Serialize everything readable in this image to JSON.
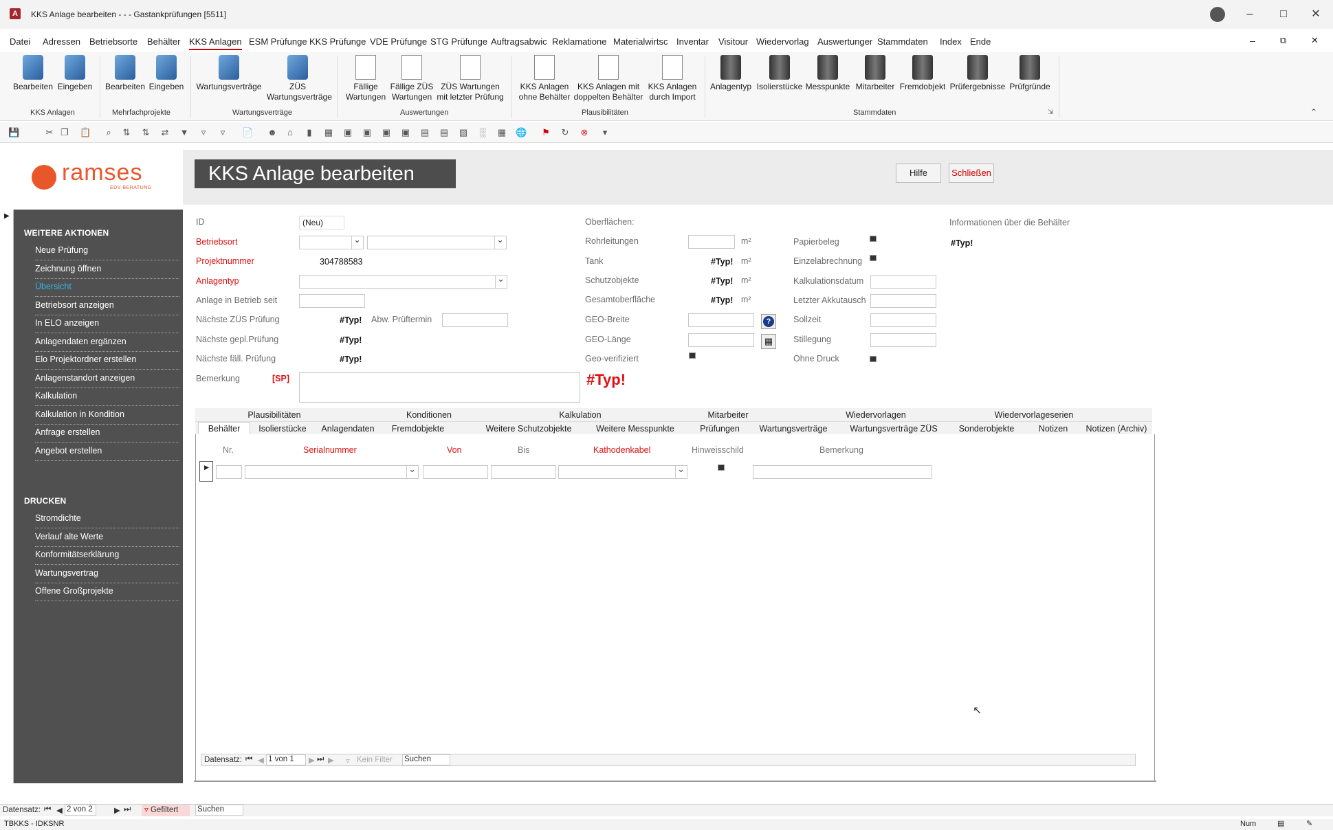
{
  "window": {
    "title": "KKS Anlage bearbeiten -  -  -  Gastankprüfungen [5511]"
  },
  "menu": [
    "Datei",
    "Adressen",
    "Betriebsorte",
    "Behälter",
    "KKS Anlagen",
    "ESM Prüfunge",
    "KKS Prüfunge",
    "VDE Prüfunge",
    "STG Prüfunge",
    "Auftragsabwic",
    "Reklamatione",
    "Materialwirtsc",
    "Inventar",
    "Visitour",
    "Wiedervorlag",
    "Auswertunger",
    "Stammdaten",
    "Index",
    "Ende"
  ],
  "ribbon": {
    "buttons": [
      {
        "label": "Bearbeiten",
        "icon": "kks-edit-icon"
      },
      {
        "label": "Eingeben",
        "icon": "kks-add-icon"
      },
      {
        "label": "Bearbeiten",
        "icon": "project-edit-icon"
      },
      {
        "label": "Eingeben",
        "icon": "project-add-icon"
      },
      {
        "label": "Wartungsverträge",
        "icon": "contract-icon"
      },
      {
        "label": "ZÜS Wartungsverträge",
        "icon": "zues-contract-icon"
      },
      {
        "label": "Fällige Wartungen",
        "icon": "report-icon"
      },
      {
        "label": "Fällige ZÜS Wartungen",
        "icon": "report-icon"
      },
      {
        "label": "ZÜS Wartungen mit letzter Prüfung",
        "icon": "report-icon"
      },
      {
        "label": "KKS Anlagen ohne Behälter",
        "icon": "check-icon"
      },
      {
        "label": "KKS Anlagen mit doppelten Behälter",
        "icon": "check-icon"
      },
      {
        "label": "KKS Anlagen durch Import",
        "icon": "check-icon"
      },
      {
        "label": "Anlagentyp",
        "icon": "binder-icon"
      },
      {
        "label": "Isolierstücke",
        "icon": "binder-icon"
      },
      {
        "label": "Messpunkte",
        "icon": "binder-icon"
      },
      {
        "label": "Mitarbeiter",
        "icon": "binder-icon"
      },
      {
        "label": "Fremdobjekt",
        "icon": "binder-icon"
      },
      {
        "label": "Prüfergebnisse",
        "icon": "binder-icon"
      },
      {
        "label": "Prüfgründe",
        "icon": "binder-icon"
      }
    ],
    "groups": [
      "KKS Anlagen",
      "Mehrfachprojekte",
      "Wartungsverträge",
      "Auswertungen",
      "Plausibilitäten",
      "Stammdaten"
    ]
  },
  "logo": {
    "name": "ramses",
    "sub": "EDV BERATUNG"
  },
  "form": {
    "title": "KKS Anlage bearbeiten",
    "help": "Hilfe",
    "close": "Schließen"
  },
  "sidebar": {
    "actions_title": "WEITERE AKTIONEN",
    "actions": [
      "Neue Prüfung",
      "Zeichnung öffnen",
      "Übersicht",
      "Betriebsort anzeigen",
      "In ELO anzeigen",
      "Anlagendaten ergänzen",
      "Elo Projektordner erstellen",
      "Anlagenstandort anzeigen",
      "Kalkulation",
      "Kalkulation in Kondition",
      "Anfrage erstellen",
      "Angebot erstellen"
    ],
    "print_title": "DRUCKEN",
    "print": [
      "Stromdichte",
      "Verlauf alte Werte",
      "Konformitätserklärung",
      "Wartungsvertrag",
      "Offene Großprojekte"
    ]
  },
  "fields": {
    "id_label": "ID",
    "id_value": "(Neu)",
    "betriebsort_label": "Betriebsort",
    "projektnummer_label": "Projektnummer",
    "projektnummer_value": "304788583",
    "anlagentyp_label": "Anlagentyp",
    "inbetrieb_label": "Anlage in Betrieb seit",
    "zues_label": "Nächste ZÜS Prüfung",
    "zues_value": "#Typ!",
    "abw_label": "Abw. Prüftermin",
    "gepl_label": "Nächste gepl.Prüfung",
    "gepl_value": "#Typ!",
    "faell_label": "Nächste fäll. Prüfung",
    "faell_value": "#Typ!",
    "bemerkung_label": "Bemerkung",
    "sp_label": "[SP]",
    "big_error": "#Typ!",
    "oberflaechen_label": "Oberflächen:",
    "rohr_label": "Rohrleitungen",
    "unit": "m²",
    "tank_label": "Tank",
    "tank_value": "#Typ!",
    "schutz_label": "Schutzobjekte",
    "schutz_value": "#Typ!",
    "gesamt_label": "Gesamtoberfläche",
    "gesamt_value": "#Typ!",
    "geob_label": "GEO-Breite",
    "geol_label": "GEO-Länge",
    "geov_label": "Geo-verifiziert",
    "papier_label": "Papierbeleg",
    "einzel_label": "Einzelabrechnung",
    "kalkdat_label": "Kalkulationsdatum",
    "akku_label": "Letzter Akkutausch",
    "soll_label": "Sollzeit",
    "still_label": "Stillegung",
    "druck_label": "Ohne Druck",
    "info_label": "Informationen über die Behälter",
    "info_value": "#Typ!"
  },
  "tabs_top": [
    "Plausibilitäten",
    "Konditionen",
    "Kalkulation",
    "Mitarbeiter",
    "Wiedervorlagen",
    "Wiedervorlageserien"
  ],
  "tabs_bottom": [
    "Behälter",
    "Isolierstücke",
    "Anlagendaten",
    "Fremdobjekte",
    "Weitere Schutzobjekte",
    "Weitere Messpunkte",
    "Prüfungen",
    "Wartungsverträge",
    "Wartungsverträge ZÜS",
    "Sonderobjekte",
    "Notizen",
    "Notizen (Archiv)"
  ],
  "grid": {
    "headers": [
      "Nr.",
      "Serialnummer",
      "Von",
      "Bis",
      "Kathodenkabel",
      "Hinweisschild",
      "Bemerkung"
    ]
  },
  "subnav": {
    "label": "Datensatz:",
    "pos": "1 von 1",
    "filter": "Kein Filter",
    "search": "Suchen"
  },
  "mainnav": {
    "label": "Datensatz:",
    "pos": "2 von 2",
    "filter": "Gefiltert",
    "search": "Suchen"
  },
  "status": {
    "left": "TBKKS - IDKSNR",
    "num": "Num"
  }
}
